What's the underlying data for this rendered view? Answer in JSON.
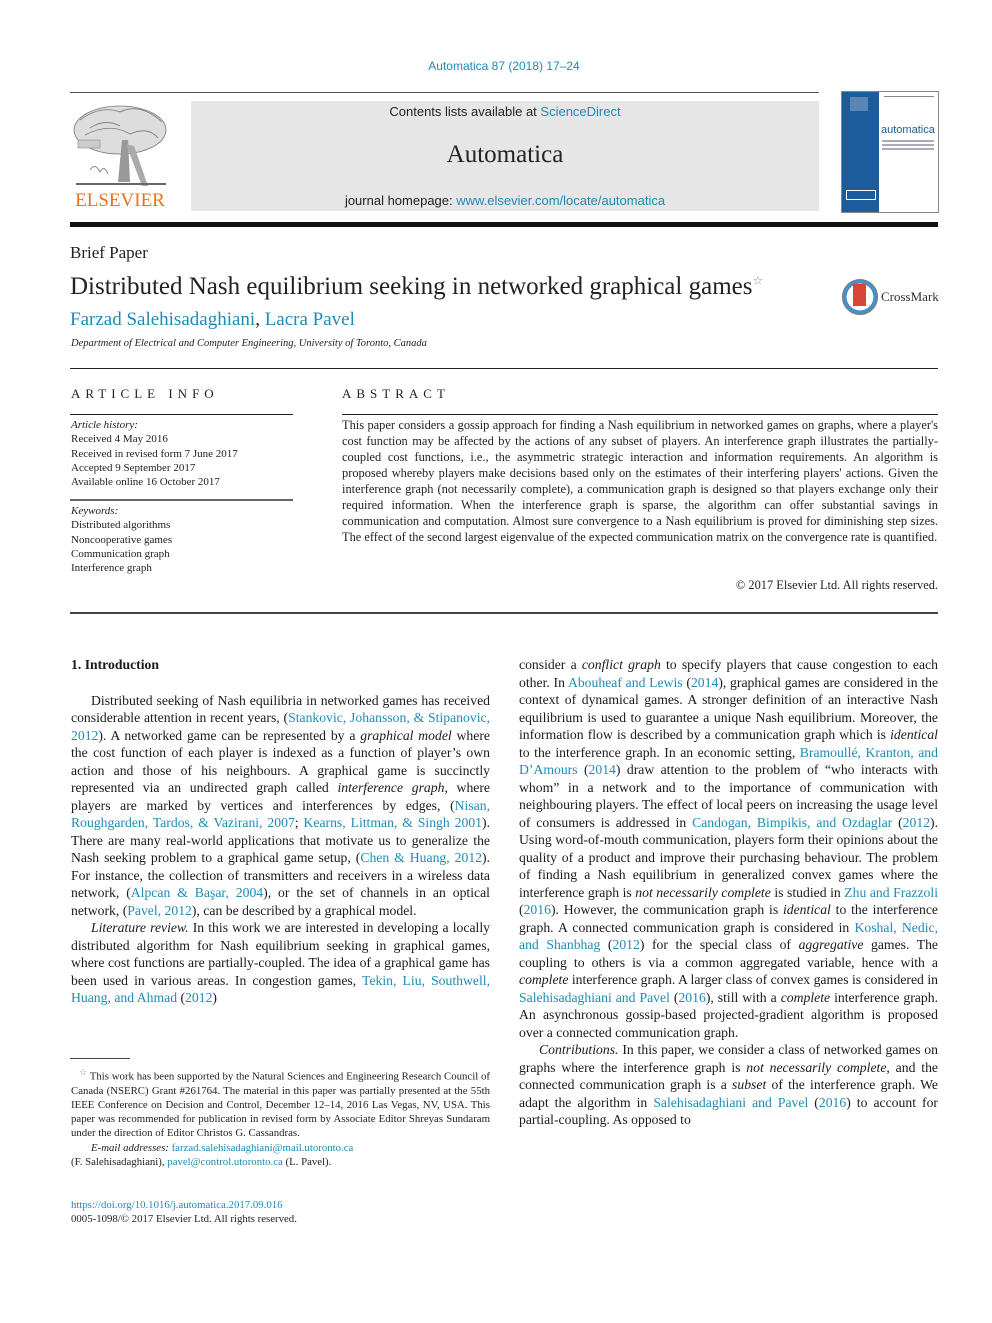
{
  "header": {
    "journal_ref": "Automatica 87 (2018) 17–24",
    "publisher_wordmark": "ELSEVIER",
    "contents_prefix": "Contents lists available at ",
    "contents_link": "ScienceDirect",
    "journal_name": "Automatica",
    "homepage_prefix": "journal homepage: ",
    "homepage_link": "www.elsevier.com/locate/automatica",
    "cover_title": "automatica",
    "colors": {
      "link": "#1f8bb5",
      "elsevier_orange": "#e8701e",
      "cover_blue": "#1d5c9c",
      "masthead_bg": "#e6e6e6"
    }
  },
  "article": {
    "type": "Brief Paper",
    "title": "Distributed Nash equilibrium seeking in networked graphical games",
    "title_footnote_mark": "☆",
    "crossmark_label": "CrossMark",
    "authors": [
      "Farzad Salehisadaghiani",
      "Lacra Pavel"
    ],
    "author_separator": ", ",
    "affiliation": "Department of Electrical and Computer Engineering, University of Toronto, Canada"
  },
  "article_info": {
    "heading": "ARTICLE INFO",
    "history_label": "Article history:",
    "history": [
      "Received 4 May 2016",
      "Received in revised form 7 June 2017",
      "Accepted 9 September 2017",
      "Available online 16 October 2017"
    ],
    "keywords_label": "Keywords:",
    "keywords": [
      "Distributed algorithms",
      "Noncooperative games",
      "Communication graph",
      "Interference graph"
    ]
  },
  "abstract": {
    "heading": "ABSTRACT",
    "text": "This paper considers a gossip approach for finding a Nash equilibrium in networked games on graphs, where a player's cost function may be affected by the actions of any subset of players. An interference graph illustrates the partially-coupled cost functions, i.e., the asymmetric strategic interaction and information requirements. An algorithm is proposed whereby players make decisions based only on the estimates of their interfering players' actions. Given the interference graph (not necessarily complete), a communication graph is designed so that players exchange only their required information. When the interference graph is sparse, the algorithm can offer substantial savings in communication and computation. Almost sure convergence to a Nash equilibrium is proved for diminishing step sizes. The effect of the second largest eigenvalue of the expected communication matrix on the convergence rate is quantified.",
    "copyright": "© 2017 Elsevier Ltd. All rights reserved."
  },
  "body": {
    "section_title": "1.  Introduction",
    "left_paragraphs": [
      [
        {
          "t": "Distributed seeking of Nash equilibria in networked games has received considerable attention in recent years, ("
        },
        {
          "t": "Stankovic, Johansson, & Stipanovic, 2012",
          "link": true
        },
        {
          "t": "). A networked game can be represented by a "
        },
        {
          "t": "graphical model",
          "it": true
        },
        {
          "t": " where the cost function of each player is indexed as a function of player’s own action and those of his neighbours. A graphical game is succinctly represented via an undirected graph called "
        },
        {
          "t": "interference graph",
          "it": true
        },
        {
          "t": ", where players are marked by vertices and interferences by edges, ("
        },
        {
          "t": "Nisan, Roughgarden, Tardos, & Vazirani, 2007",
          "link": true
        },
        {
          "t": "; "
        },
        {
          "t": "Kearns, Littman, & Singh 2001",
          "link": true
        },
        {
          "t": "). There are many real-world applications that motivate us to generalize the Nash seeking problem to a graphical game setup, ("
        },
        {
          "t": "Chen & Huang, 2012",
          "link": true
        },
        {
          "t": "). For instance, the collection of transmitters and receivers in a wireless data network, ("
        },
        {
          "t": "Alpcan & Başar, 2004",
          "link": true
        },
        {
          "t": "), or the set of channels in an optical network, ("
        },
        {
          "t": "Pavel, 2012",
          "link": true
        },
        {
          "t": "), can be described by a graphical model."
        }
      ],
      [
        {
          "t": "Literature review.",
          "it": true
        },
        {
          "t": " In this work we are interested in developing a locally distributed algorithm for Nash equilibrium seeking in graphical games, where cost functions are partially-coupled. The idea of a graphical game has been used in various areas. In congestion games, "
        },
        {
          "t": "Tekin, Liu, Southwell, Huang, and Ahmad",
          "link": true
        },
        {
          "t": " ("
        },
        {
          "t": "2012",
          "link": true
        },
        {
          "t": ")"
        }
      ]
    ],
    "right_paragraphs": [
      [
        {
          "t": "consider a "
        },
        {
          "t": "conflict graph",
          "it": true
        },
        {
          "t": " to specify players that cause congestion to each other. In "
        },
        {
          "t": "Abouheaf and Lewis",
          "link": true
        },
        {
          "t": " ("
        },
        {
          "t": "2014",
          "link": true
        },
        {
          "t": "), graphical games are considered in the context of dynamical games. A stronger definition of an interactive Nash equilibrium is used to guarantee a unique Nash equilibrium. Moreover, the information flow is described by a communication graph which is "
        },
        {
          "t": "identical",
          "it": true
        },
        {
          "t": " to the interference graph. In an economic setting, "
        },
        {
          "t": "Bramoullé, Kranton, and D’Amours",
          "link": true
        },
        {
          "t": " ("
        },
        {
          "t": "2014",
          "link": true
        },
        {
          "t": ") draw attention to the problem of “who interacts with whom” in a network and to the importance of communication with neighbouring players. The effect of local peers on increasing the usage level of consumers is addressed in "
        },
        {
          "t": "Candogan, Bimpikis, and Ozdaglar",
          "link": true
        },
        {
          "t": " ("
        },
        {
          "t": "2012",
          "link": true
        },
        {
          "t": "). Using word-of-mouth communication, players form their opinions about the quality of a product and improve their purchasing behaviour. The problem of finding a Nash equilibrium in generalized convex games where the interference graph is "
        },
        {
          "t": "not necessarily complete",
          "it": true
        },
        {
          "t": " is studied in "
        },
        {
          "t": "Zhu and Frazzoli",
          "link": true
        },
        {
          "t": " ("
        },
        {
          "t": "2016",
          "link": true
        },
        {
          "t": "). However, the communication graph is "
        },
        {
          "t": "identical",
          "it": true
        },
        {
          "t": " to the interference graph. A connected communication graph is considered in "
        },
        {
          "t": "Koshal, Nedic, and Shanbhag",
          "link": true
        },
        {
          "t": " ("
        },
        {
          "t": "2012",
          "link": true
        },
        {
          "t": ") for the special class of "
        },
        {
          "t": "aggregative",
          "it": true
        },
        {
          "t": " games. The coupling to others is via a common aggregated variable, hence with a "
        },
        {
          "t": "complete",
          "it": true
        },
        {
          "t": " interference graph. A larger class of convex games is considered in "
        },
        {
          "t": "Salehisadaghiani and Pavel",
          "link": true
        },
        {
          "t": " ("
        },
        {
          "t": "2016",
          "link": true
        },
        {
          "t": "), still with a "
        },
        {
          "t": "complete",
          "it": true
        },
        {
          "t": " interference graph. An asynchronous gossip-based projected-gradient algorithm is proposed over a connected communication graph."
        }
      ],
      [
        {
          "t": "Contributions.",
          "it": true
        },
        {
          "t": " In this paper, we consider a class of networked games on graphs where the interference graph is "
        },
        {
          "t": "not necessarily complete",
          "it": true
        },
        {
          "t": ", and the connected communication graph is a "
        },
        {
          "t": "subset",
          "it": true
        },
        {
          "t": " of the interference graph. We adapt the algorithm in "
        },
        {
          "t": "Salehisadaghiani and Pavel",
          "link": true
        },
        {
          "t": " ("
        },
        {
          "t": "2016",
          "link": true
        },
        {
          "t": ") to account for partial-coupling. As opposed to"
        }
      ]
    ]
  },
  "footnote": {
    "mark": "☆",
    "text": " This work has been supported by the Natural Sciences and Engineering Research Council of Canada (NSERC) Grant #261764. The material in this paper was partially presented at the 55th IEEE Conference on Decision and Control, December 12–14, 2016 Las Vegas, NV, USA. This paper was recommended for publication in revised form by Associate Editor Shreyas Sundaram under the direction of Editor Christos G. Cassandras.",
    "email_label": "E-mail addresses:",
    "email_1": "farzad.salehisadaghiani@mail.utoronto.ca",
    "email_1_owner": " (F. Salehisadaghiani), ",
    "email_2": "pavel@control.utoronto.ca",
    "email_2_owner": " (L. Pavel).",
    "doi": "https://doi.org/10.1016/j.automatica.2017.09.016",
    "issn_line": "0005-1098/© 2017 Elsevier Ltd. All rights reserved."
  }
}
